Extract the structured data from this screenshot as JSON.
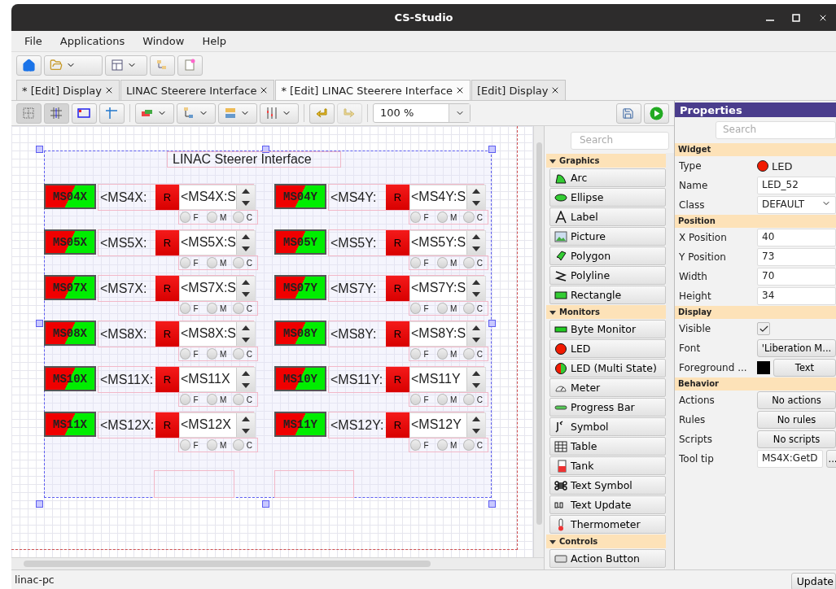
{
  "window": {
    "title": "CS-Studio"
  },
  "menu": [
    "File",
    "Applications",
    "Window",
    "Help"
  ],
  "tabs": [
    {
      "label": "* [Edit] Display",
      "selected": false
    },
    {
      "label": "LINAC Steerere Interface",
      "selected": false
    },
    {
      "label": "* [Edit] LINAC Steerere Interface",
      "selected": true
    },
    {
      "label": "[Edit] Display",
      "selected": false
    }
  ],
  "editor_toolbar": {
    "zoom": "100 %"
  },
  "display": {
    "title": "LINAC Steerer Interface",
    "columns": [
      {
        "steerers": [
          {
            "led": "MS04X",
            "readback": "<MS4X:",
            "button": "R",
            "setpoint": "<MS4X:S",
            "modes": [
              {
                "label": "F",
                "selected": false
              },
              {
                "label": "M",
                "selected": false
              },
              {
                "label": "C",
                "selected": false
              }
            ]
          },
          {
            "led": "MS05X",
            "readback": "<MS5X:",
            "button": "R",
            "setpoint": "<MS5X:S",
            "modes": [
              {
                "label": "F",
                "selected": false
              },
              {
                "label": "M",
                "selected": false
              },
              {
                "label": "C",
                "selected": false
              }
            ]
          },
          {
            "led": "MS07X",
            "readback": "<MS7X:",
            "button": "R",
            "setpoint": "<MS7X:S",
            "modes": [
              {
                "label": "F",
                "selected": false
              },
              {
                "label": "M",
                "selected": false
              },
              {
                "label": "C",
                "selected": false
              }
            ]
          },
          {
            "led": "MS08X",
            "readback": "<MS8X:",
            "button": "R",
            "setpoint": "<MS8X:S",
            "modes": [
              {
                "label": "F",
                "selected": false
              },
              {
                "label": "M",
                "selected": false
              },
              {
                "label": "C",
                "selected": false
              }
            ]
          },
          {
            "led": "MS10X",
            "readback": "<MS11X:",
            "button": "R",
            "setpoint": "<MS11X",
            "modes": [
              {
                "label": "F",
                "selected": false
              },
              {
                "label": "M",
                "selected": false
              },
              {
                "label": "C",
                "selected": false
              }
            ]
          },
          {
            "led": "MS11X",
            "readback": "<MS12X:",
            "button": "R",
            "setpoint": "<MS12X",
            "modes": [
              {
                "label": "F",
                "selected": false
              },
              {
                "label": "M",
                "selected": false
              },
              {
                "label": "C",
                "selected": false
              }
            ]
          }
        ]
      },
      {
        "steerers": [
          {
            "led": "MS04Y",
            "readback": "<MS4Y:",
            "button": "R",
            "setpoint": "<MS4Y:S",
            "modes": [
              {
                "label": "F",
                "selected": false
              },
              {
                "label": "M",
                "selected": false
              },
              {
                "label": "C",
                "selected": false
              }
            ]
          },
          {
            "led": "MS05Y",
            "readback": "<MS5Y:",
            "button": "R",
            "setpoint": "<MS5Y:S",
            "modes": [
              {
                "label": "F",
                "selected": false
              },
              {
                "label": "M",
                "selected": false
              },
              {
                "label": "C",
                "selected": false
              }
            ]
          },
          {
            "led": "MS07Y",
            "readback": "<MS7Y:",
            "button": "R",
            "setpoint": "<MS7Y:S",
            "modes": [
              {
                "label": "F",
                "selected": false
              },
              {
                "label": "M",
                "selected": false
              },
              {
                "label": "C",
                "selected": false
              }
            ]
          },
          {
            "led": "MS08Y",
            "readback": "<MS8Y:",
            "button": "R",
            "setpoint": "<MS8Y:S",
            "modes": [
              {
                "label": "F",
                "selected": false
              },
              {
                "label": "M",
                "selected": false
              },
              {
                "label": "C",
                "selected": false
              }
            ]
          },
          {
            "led": "MS10Y",
            "readback": "<MS11Y:",
            "button": "R",
            "setpoint": "<MS11Y",
            "modes": [
              {
                "label": "F",
                "selected": false
              },
              {
                "label": "M",
                "selected": false
              },
              {
                "label": "C",
                "selected": false
              }
            ]
          },
          {
            "led": "MS11Y",
            "readback": "<MS12Y:",
            "button": "R",
            "setpoint": "<MS12Y",
            "modes": [
              {
                "label": "F",
                "selected": false
              },
              {
                "label": "M",
                "selected": false
              },
              {
                "label": "C",
                "selected": false
              }
            ]
          }
        ]
      }
    ]
  },
  "palette": {
    "search": {
      "placeholder": "Search"
    },
    "sections": [
      {
        "title": "Graphics",
        "expanded": true,
        "items": [
          "Arc",
          "Ellipse",
          "Label",
          "Picture",
          "Polygon",
          "Polyline",
          "Rectangle"
        ]
      },
      {
        "title": "Monitors",
        "expanded": true,
        "items": [
          "Byte Monitor",
          "LED",
          "LED (Multi State)",
          "Meter",
          "Progress Bar",
          "Symbol",
          "Table",
          "Tank",
          "Text Symbol",
          "Text Update",
          "Thermometer"
        ]
      },
      {
        "title": "Controls",
        "expanded": true,
        "items": [
          "Action Button"
        ]
      }
    ]
  },
  "properties": {
    "title": "Properties",
    "search": {
      "placeholder": "Search"
    },
    "sections": [
      {
        "title": "Widget",
        "rows": [
          {
            "kind": "type",
            "label": "Type",
            "value": "LED"
          },
          {
            "kind": "field",
            "label": "Name",
            "value": "LED_52"
          },
          {
            "kind": "combo",
            "label": "Class",
            "value": "DEFAULT"
          }
        ]
      },
      {
        "title": "Position",
        "rows": [
          {
            "kind": "field",
            "label": "X Position",
            "value": "40"
          },
          {
            "kind": "field",
            "label": "Y Position",
            "value": "73"
          },
          {
            "kind": "field",
            "label": "Width",
            "value": "70"
          },
          {
            "kind": "field",
            "label": "Height",
            "value": "34"
          }
        ]
      },
      {
        "title": "Display",
        "rows": [
          {
            "kind": "checkbox",
            "label": "Visible",
            "checked": true
          },
          {
            "kind": "button",
            "label": "Font",
            "value": "'Liberation M..."
          },
          {
            "kind": "color",
            "label": "Foreground ...",
            "color": "#000000",
            "value": "Text"
          }
        ]
      },
      {
        "title": "Behavior",
        "rows": [
          {
            "kind": "button",
            "label": "Actions",
            "value": "No actions"
          },
          {
            "kind": "button",
            "label": "Rules",
            "value": "No rules"
          },
          {
            "kind": "button",
            "label": "Scripts",
            "value": "No scripts"
          },
          {
            "kind": "fieldmore",
            "label": "Tool tip",
            "value": "MS4X:GetD",
            "more": "..."
          }
        ]
      }
    ]
  },
  "status_bar": {
    "host": "linac-pc",
    "button": "Update"
  }
}
